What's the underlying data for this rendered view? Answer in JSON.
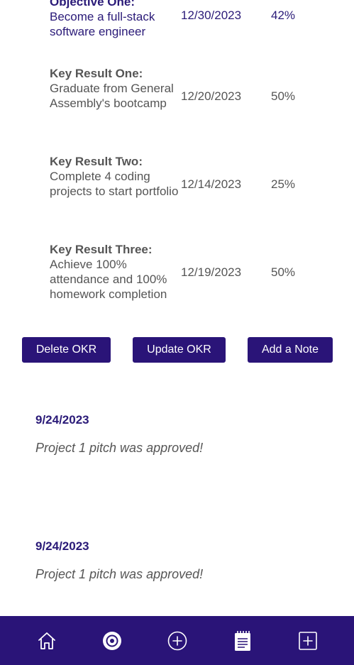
{
  "okrs": [
    {
      "heading": "Objective One:",
      "text": "Become a full-stack software engineer",
      "date": "12/30/2023",
      "percent": "42%"
    },
    {
      "heading": "Key Result One:",
      "text": "Graduate from General Assembly's bootcamp",
      "date": "12/20/2023",
      "percent": "50%"
    },
    {
      "heading": "Key Result Two:",
      "text": "Complete 4 coding projects to start portfolio",
      "date": "12/14/2023",
      "percent": "25%"
    },
    {
      "heading": "Key Result Three:",
      "text": "Achieve 100% attendance and 100% homework completion",
      "date": "12/19/2023",
      "percent": "50%"
    }
  ],
  "actions": {
    "delete_label": "Delete OKR",
    "update_label": "Update OKR",
    "add_note_label": "Add a Note"
  },
  "notes": [
    {
      "date": "9/24/2023",
      "text": "Project 1 pitch was approved!"
    },
    {
      "date": "9/24/2023",
      "text": "Project 1 pitch was approved!"
    }
  ],
  "nav": {
    "items": [
      "home-icon",
      "target-icon",
      "plus-circle-icon",
      "notepad-icon",
      "plus-square-icon"
    ],
    "active": "target-icon",
    "background": "#2a1478",
    "icon_color": "#ffffff"
  },
  "colors": {
    "brand": "#2a1478",
    "objective_text": "#2a1a78",
    "body_text": "#555555"
  }
}
